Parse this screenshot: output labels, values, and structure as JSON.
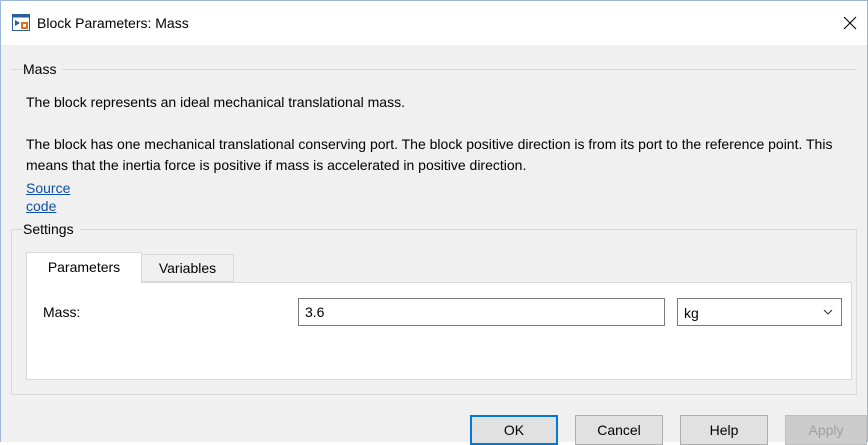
{
  "window": {
    "title": "Block Parameters: Mass",
    "close_glyph": "✕",
    "icon": "simulink-block-icon"
  },
  "description_group": {
    "label": "Mass",
    "paragraph_1": "The block represents an ideal mechanical translational mass.",
    "paragraph_2": "The block has one mechanical translational conserving port. The block positive direction is from its port to the reference point. This means that the inertia force is positive if mass is accelerated in positive direction.",
    "link_label": "Source code"
  },
  "settings_group": {
    "label": "Settings",
    "tabs": [
      {
        "label": "Parameters",
        "active": true
      },
      {
        "label": "Variables",
        "active": false
      }
    ],
    "fields": [
      {
        "label": "Mass:",
        "value": "3.6",
        "unit": "kg"
      }
    ]
  },
  "buttons": {
    "ok": "OK",
    "cancel": "Cancel",
    "help": "Help",
    "apply": "Apply"
  },
  "colors": {
    "link": "#0f4fa8",
    "focus_border": "#0078d7",
    "window_border": "#9ab8d6"
  }
}
